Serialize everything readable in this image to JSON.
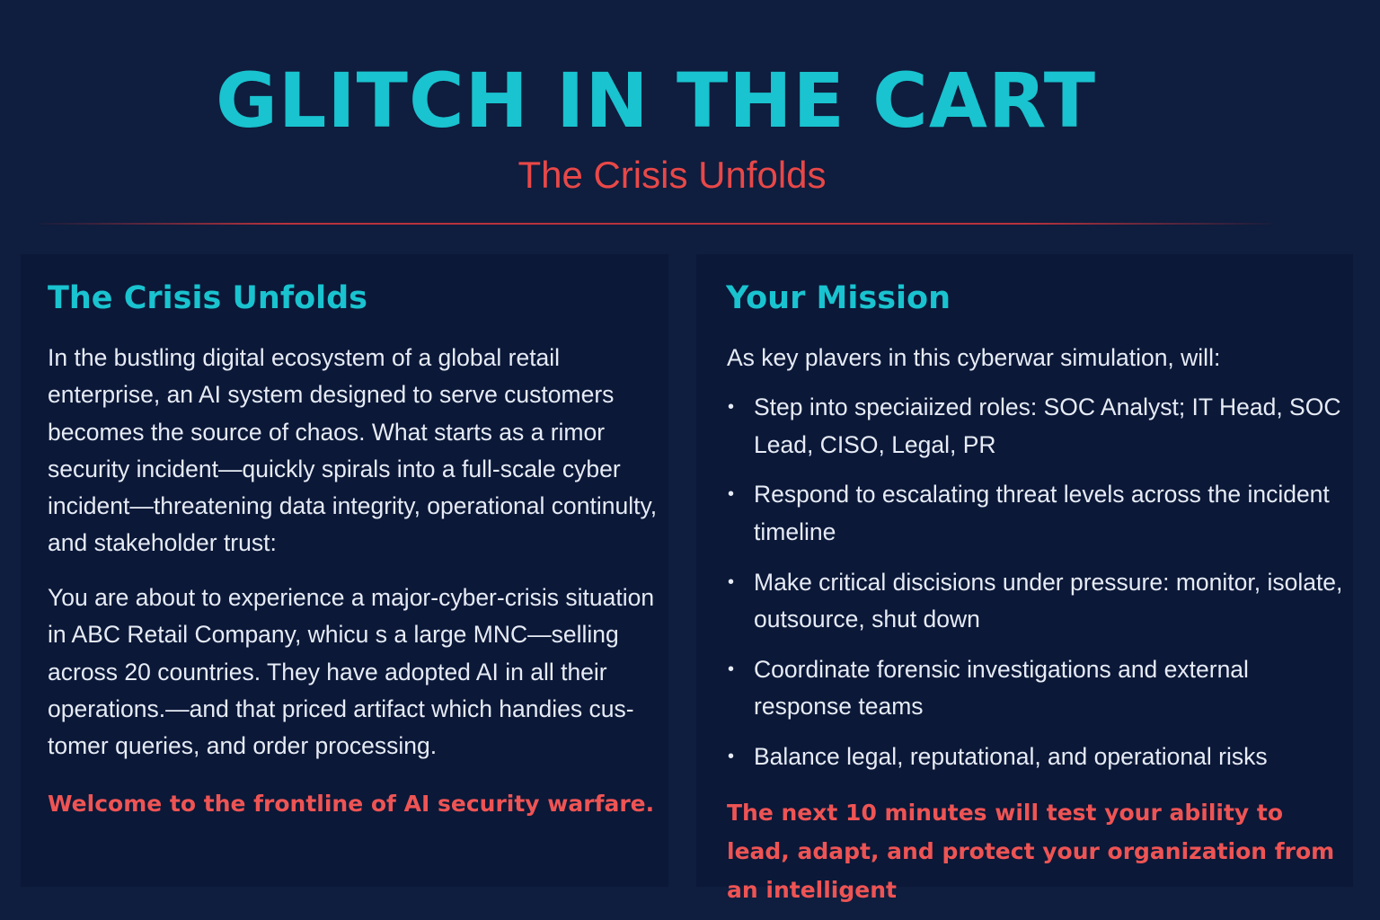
{
  "header": {
    "title": "GLITCH IN THE CART",
    "subtitle": "The Crisis Unfolds"
  },
  "left_panel": {
    "heading": "The Crisis Unfolds",
    "paragraph1": "In the bustling digital ecosystem of a global retail enterprise, an AI system designed to serve customers becomes the source of chaos. What starts as a rimor security incident—quickly spirals into a full-scale cyber incident—threatening data integrity, operational continulty, and stakeholder trust:",
    "paragraph2": "You are about to experience a major-cyber-crisis situation in ABC Retail Company, whicu s a large MNC—selling across 20 countries. They have adopted AI in all their operations.—and that priced artifact which handies cus- tomer queries, and order processing.",
    "callout": "Welcome to the frontline of AI security warfare."
  },
  "right_panel": {
    "heading": "Your Mission",
    "intro": "As key plavers in this cyberwar simulation, will:",
    "bullets": [
      "Step into speciaiized roles: SOC Analyst; IT Head, SOC Lead, CISO, Legal, PR",
      "Respond to escalating threat levels across the incident timeline",
      "Make critical discisions under pressure: monitor, isolate, outsource, shut down",
      "Coordinate forensic investigations and external response teams",
      "Balance legal, reputational, and operational risks"
    ],
    "callout": "The next 10 minutes will test your ability to lead, adapt, and protect your organization from an intelligent"
  },
  "colors": {
    "background": "#0f1d3e",
    "panel": "#0b1838",
    "accent_cyan": "#19c3cf",
    "accent_red": "#e84848",
    "text": "#e6ebf5"
  }
}
